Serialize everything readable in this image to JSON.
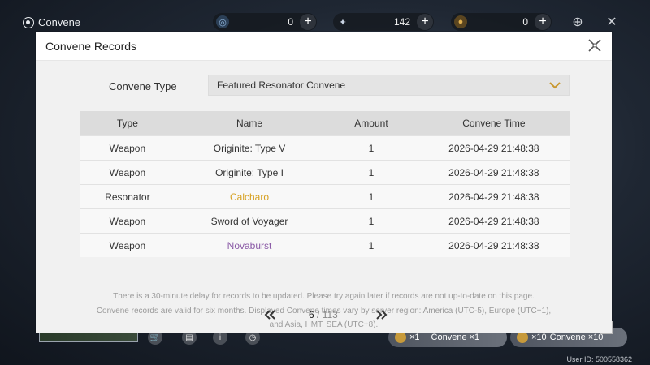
{
  "app": {
    "title": "Convene"
  },
  "currencies": [
    {
      "icon": "astrite-icon",
      "value": "0",
      "color": "#8fb3d9"
    },
    {
      "icon": "lunite-icon",
      "value": "142",
      "color": "#c9d3e3"
    },
    {
      "icon": "tide-coin-icon",
      "value": "0",
      "color": "#c79a3b"
    }
  ],
  "modal": {
    "title": "Convene Records",
    "convene_type_label": "Convene Type",
    "convene_type_value": "Featured Resonator Convene",
    "table": {
      "headers": [
        "Type",
        "Name",
        "Amount",
        "Convene Time"
      ],
      "rows": [
        {
          "type": "Weapon",
          "name": "Originite: Type V",
          "amount": "1",
          "time": "2026-04-29 21:48:38",
          "rarity": "normal"
        },
        {
          "type": "Weapon",
          "name": "Originite: Type I",
          "amount": "1",
          "time": "2026-04-29 21:48:38",
          "rarity": "normal"
        },
        {
          "type": "Resonator",
          "name": "Calcharo",
          "amount": "1",
          "time": "2026-04-29 21:48:38",
          "rarity": "gold"
        },
        {
          "type": "Weapon",
          "name": "Sword of Voyager",
          "amount": "1",
          "time": "2026-04-29 21:48:38",
          "rarity": "normal"
        },
        {
          "type": "Weapon",
          "name": "Novaburst",
          "amount": "1",
          "time": "2026-04-29 21:48:38",
          "rarity": "purple"
        }
      ]
    },
    "notice": [
      "There is a 30-minute delay for records to be updated. Please try again later if records are not up-to-date on this page.",
      "Convene records are valid for six months. Displayed Convene times vary by server region: America (UTC-5), Europe (UTC+1),",
      "and Asia, HMT, SEA (UTC+8)."
    ],
    "pagination": {
      "current": "6",
      "separator": " / ",
      "total": "113"
    }
  },
  "bottom": {
    "convene_x1_count": "×1",
    "convene_x1_label": "Convene ×1",
    "convene_x10_count": "×10",
    "convene_x10_label": "Convene ×10",
    "user_id": "User ID: 500558362"
  },
  "colors": {
    "gold": "#d6a020",
    "purple": "#8a5aa6",
    "accent_chevron": "#c8972f"
  }
}
